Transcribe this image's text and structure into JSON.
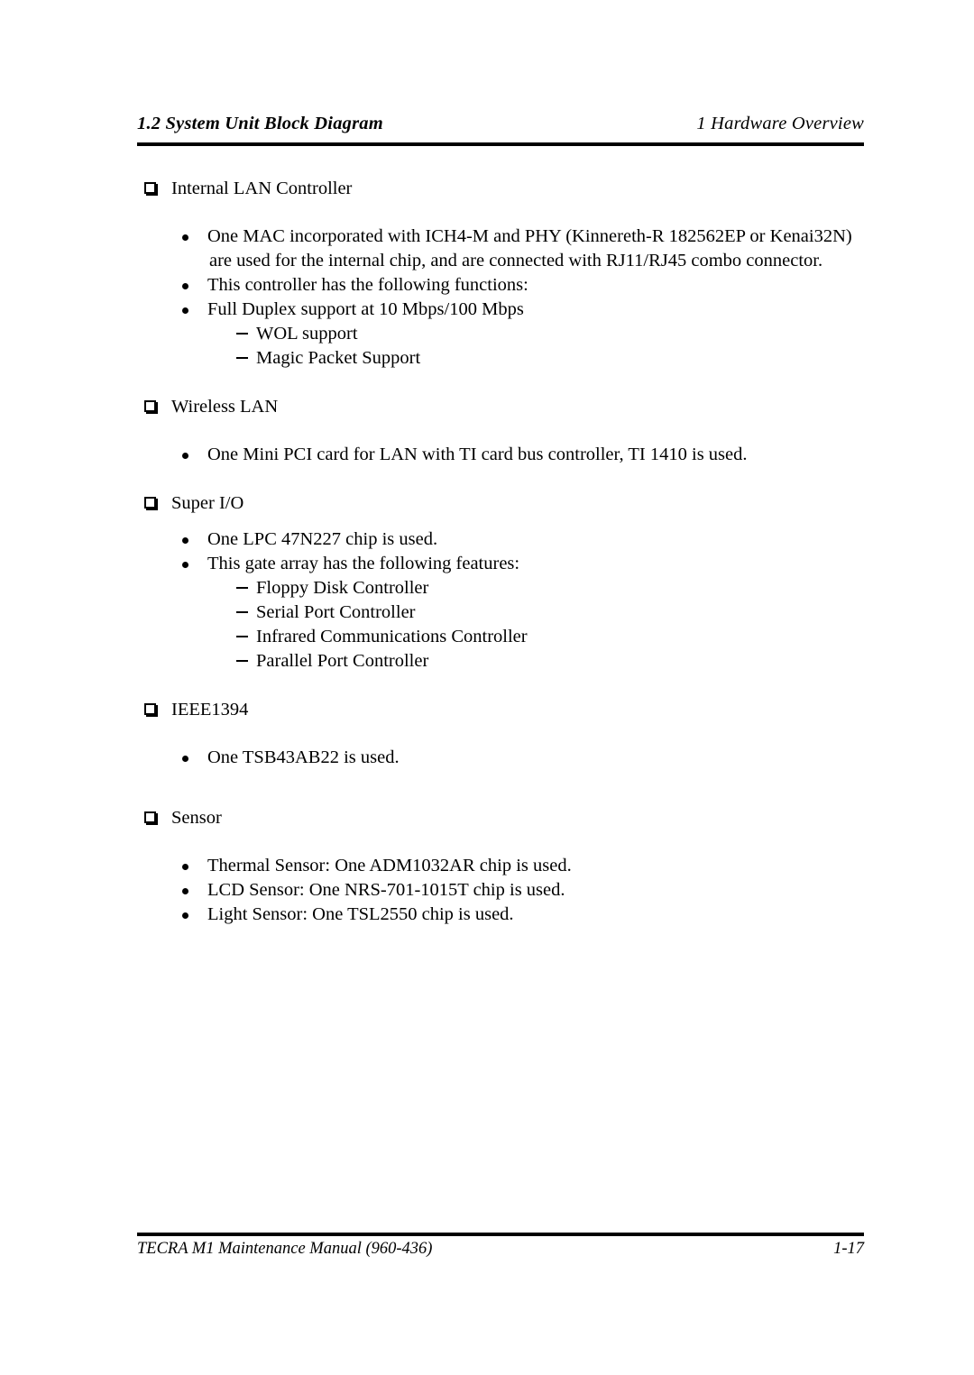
{
  "header": {
    "left": "1.2 System Unit Block Diagram",
    "right": "1  Hardware Overview"
  },
  "footer": {
    "manual": "TECRA M1 Maintenance Manual (960-436)",
    "page_number": "1-17"
  },
  "icons": {
    "square_bullet": "hollow-square-bullet",
    "round_bullet": "round-bullet",
    "dash_bullet": "en-dash-bullet"
  },
  "sections": [
    {
      "heading": "Internal LAN Controller",
      "bullets": [
        {
          "line1": "One MAC incorporated with ICH4-M and PHY (Kinnereth-R 182562EP or Kenai32N)",
          "line2": "are used for the internal chip, and are connected with RJ11/RJ45 combo connector."
        },
        {
          "line1": "This controller has the following functions:"
        },
        {
          "line1": "Full Duplex support at 10 Mbps/100 Mbps"
        }
      ],
      "dashes": [
        "WOL support",
        "Magic Packet Support"
      ]
    },
    {
      "heading": "Wireless LAN",
      "bullets": [
        {
          "line1": "One Mini PCI card for LAN with TI card bus controller, TI 1410 is used."
        }
      ],
      "dashes": []
    },
    {
      "heading": "Super I/O",
      "bullets": [
        {
          "line1": "One LPC 47N227 chip is used."
        },
        {
          "line1": "This gate array has the following features:"
        }
      ],
      "dashes": [
        "Floppy Disk Controller",
        "Serial Port Controller",
        "Infrared Communications Controller",
        "Parallel Port Controller"
      ]
    },
    {
      "heading": "IEEE1394",
      "bullets": [
        {
          "line1": "One TSB43AB22 is used."
        }
      ],
      "dashes": []
    },
    {
      "heading": "Sensor",
      "bullets": [
        {
          "line1": "Thermal Sensor: One ADM1032AR chip is used."
        },
        {
          "line1": "LCD Sensor: One NRS-701-1015T chip is used."
        },
        {
          "line1": "Light Sensor: One TSL2550 chip is used."
        }
      ],
      "dashes": []
    }
  ]
}
